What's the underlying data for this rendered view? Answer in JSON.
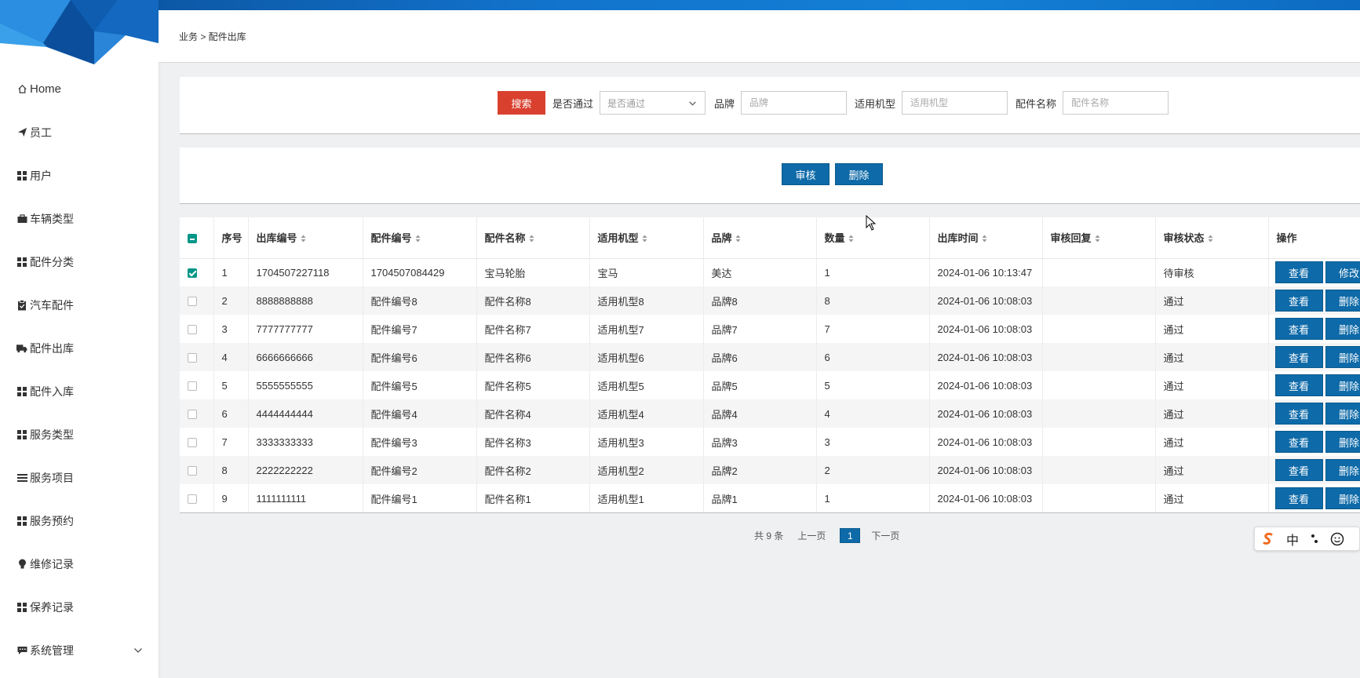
{
  "breadcrumb": "业务 > 配件出库",
  "sidebar": {
    "items": [
      {
        "label": "Home",
        "icon": "home-icon"
      },
      {
        "label": "员工",
        "icon": "paper-plane-icon"
      },
      {
        "label": "用户",
        "icon": "grid-icon"
      },
      {
        "label": "车辆类型",
        "icon": "briefcase-icon"
      },
      {
        "label": "配件分类",
        "icon": "grid-icon"
      },
      {
        "label": "汽车配件",
        "icon": "clipboard-icon"
      },
      {
        "label": "配件出库",
        "icon": "truck-icon"
      },
      {
        "label": "配件入库",
        "icon": "grid-icon"
      },
      {
        "label": "服务类型",
        "icon": "grid-icon"
      },
      {
        "label": "服务项目",
        "icon": "list-icon"
      },
      {
        "label": "服务预约",
        "icon": "grid-icon"
      },
      {
        "label": "维修记录",
        "icon": "lightbulb-icon"
      },
      {
        "label": "保养记录",
        "icon": "grid-icon"
      },
      {
        "label": "系统管理",
        "icon": "comment-icon"
      }
    ]
  },
  "search": {
    "button": "搜索",
    "passed_label": "是否通过",
    "passed_placeholder": "是否通过",
    "brand_label": "品牌",
    "brand_placeholder": "品牌",
    "model_label": "适用机型",
    "model_placeholder": "适用机型",
    "name_label": "配件名称",
    "name_placeholder": "配件名称"
  },
  "actions": {
    "review": "审核",
    "delete": "删除"
  },
  "table": {
    "headers": [
      "序号",
      "出库编号",
      "配件编号",
      "配件名称",
      "适用机型",
      "品牌",
      "数量",
      "出库时间",
      "审核回复",
      "审核状态",
      "操作"
    ],
    "rows": [
      {
        "seq": "1",
        "out_no": "1704507227118",
        "part_no": "1704507084429",
        "name": "宝马轮胎",
        "model": "宝马",
        "brand": "美达",
        "qty": "1",
        "time": "2024-01-06 10:13:47",
        "reply": "",
        "status": "待审核",
        "op1": "查看",
        "op2": "修改",
        "checked": true
      },
      {
        "seq": "2",
        "out_no": "8888888888",
        "part_no": "配件编号8",
        "name": "配件名称8",
        "model": "适用机型8",
        "brand": "品牌8",
        "qty": "8",
        "time": "2024-01-06 10:08:03",
        "reply": "",
        "status": "通过",
        "op1": "查看",
        "op2": "删除",
        "checked": false
      },
      {
        "seq": "3",
        "out_no": "7777777777",
        "part_no": "配件编号7",
        "name": "配件名称7",
        "model": "适用机型7",
        "brand": "品牌7",
        "qty": "7",
        "time": "2024-01-06 10:08:03",
        "reply": "",
        "status": "通过",
        "op1": "查看",
        "op2": "删除",
        "checked": false
      },
      {
        "seq": "4",
        "out_no": "6666666666",
        "part_no": "配件编号6",
        "name": "配件名称6",
        "model": "适用机型6",
        "brand": "品牌6",
        "qty": "6",
        "time": "2024-01-06 10:08:03",
        "reply": "",
        "status": "通过",
        "op1": "查看",
        "op2": "删除",
        "checked": false
      },
      {
        "seq": "5",
        "out_no": "5555555555",
        "part_no": "配件编号5",
        "name": "配件名称5",
        "model": "适用机型5",
        "brand": "品牌5",
        "qty": "5",
        "time": "2024-01-06 10:08:03",
        "reply": "",
        "status": "通过",
        "op1": "查看",
        "op2": "删除",
        "checked": false
      },
      {
        "seq": "6",
        "out_no": "4444444444",
        "part_no": "配件编号4",
        "name": "配件名称4",
        "model": "适用机型4",
        "brand": "品牌4",
        "qty": "4",
        "time": "2024-01-06 10:08:03",
        "reply": "",
        "status": "通过",
        "op1": "查看",
        "op2": "删除",
        "checked": false
      },
      {
        "seq": "7",
        "out_no": "3333333333",
        "part_no": "配件编号3",
        "name": "配件名称3",
        "model": "适用机型3",
        "brand": "品牌3",
        "qty": "3",
        "time": "2024-01-06 10:08:03",
        "reply": "",
        "status": "通过",
        "op1": "查看",
        "op2": "删除",
        "checked": false
      },
      {
        "seq": "8",
        "out_no": "2222222222",
        "part_no": "配件编号2",
        "name": "配件名称2",
        "model": "适用机型2",
        "brand": "品牌2",
        "qty": "2",
        "time": "2024-01-06 10:08:03",
        "reply": "",
        "status": "通过",
        "op1": "查看",
        "op2": "删除",
        "checked": false
      },
      {
        "seq": "9",
        "out_no": "1111111111",
        "part_no": "配件编号1",
        "name": "配件名称1",
        "model": "适用机型1",
        "brand": "品牌1",
        "qty": "1",
        "time": "2024-01-06 10:08:03",
        "reply": "",
        "status": "通过",
        "op1": "查看",
        "op2": "删除",
        "checked": false
      }
    ]
  },
  "pager": {
    "total": "共 9 条",
    "prev": "上一页",
    "current": "1",
    "next": "下一页"
  },
  "ime": {
    "lang": "中"
  },
  "colors": {
    "accent_blue": "#0e6aa8",
    "search_red": "#d9412e",
    "check_green": "#009688",
    "topbar": "#1273cc"
  }
}
